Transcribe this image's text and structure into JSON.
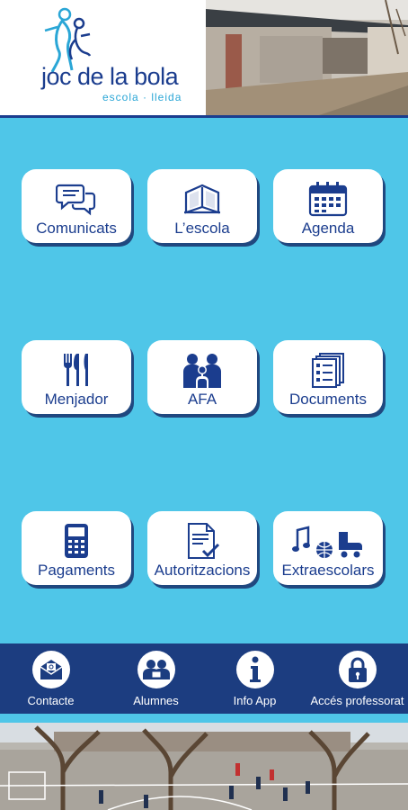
{
  "header": {
    "logo_title": "joc de la bola",
    "logo_subtitle": "escola · lleida"
  },
  "grid": [
    {
      "label": "Comunicats",
      "icon": "chat-bubbles-icon"
    },
    {
      "label": "L’escola",
      "icon": "open-book-icon"
    },
    {
      "label": "Agenda",
      "icon": "calendar-icon"
    },
    {
      "label": "Menjador",
      "icon": "cutlery-icon"
    },
    {
      "label": "AFA",
      "icon": "family-icon"
    },
    {
      "label": "Documents",
      "icon": "documents-icon"
    },
    {
      "label": "Pagaments",
      "icon": "payment-terminal-icon"
    },
    {
      "label": "Autoritzacions",
      "icon": "document-check-icon"
    },
    {
      "label": "Extraescolars",
      "icon": "activities-icon"
    }
  ],
  "bottom_nav": [
    {
      "label": "Contacte",
      "icon": "envelope-icon"
    },
    {
      "label": "Alumnes",
      "icon": "students-icon"
    },
    {
      "label": "Info App",
      "icon": "info-icon"
    },
    {
      "label": "Accés professorat",
      "icon": "lock-icon"
    }
  ],
  "colors": {
    "background": "#4fc6e8",
    "brand_dark": "#1b3d8e",
    "nav_background": "#1c3d80",
    "button_background": "#ffffff"
  }
}
